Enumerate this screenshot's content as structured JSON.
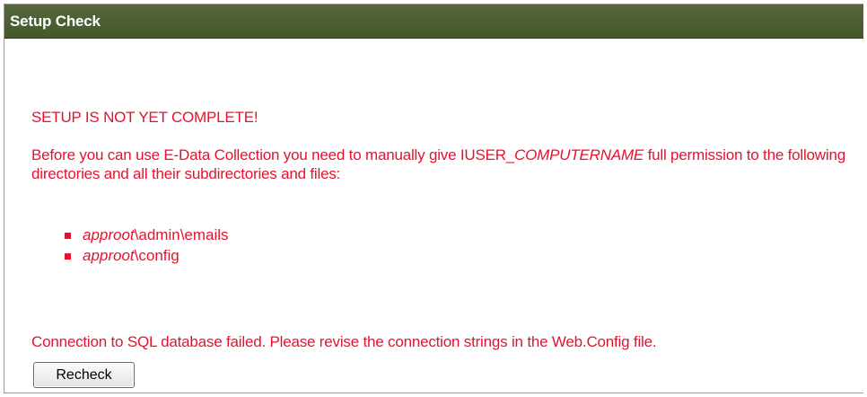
{
  "header": {
    "title": "Setup Check"
  },
  "content": {
    "warning": "SETUP IS NOT YET COMPLETE!",
    "message": {
      "part1": "Before you can use E-Data Collection you need to manually give IUSER_",
      "computername": "COMPUTERNAME",
      "part2": " full permission to the following directories and all their subdirectories and files:"
    },
    "directories": [
      {
        "root": "approot",
        "path": "\\admin\\emails"
      },
      {
        "root": "approot",
        "path": "\\config"
      }
    ],
    "db_error": "Connection to SQL database failed. Please revise the connection strings in the Web.Config file.",
    "recheck_label": "Recheck"
  },
  "colors": {
    "header_bg": "#4d6032",
    "text_red": "#e8112d"
  }
}
